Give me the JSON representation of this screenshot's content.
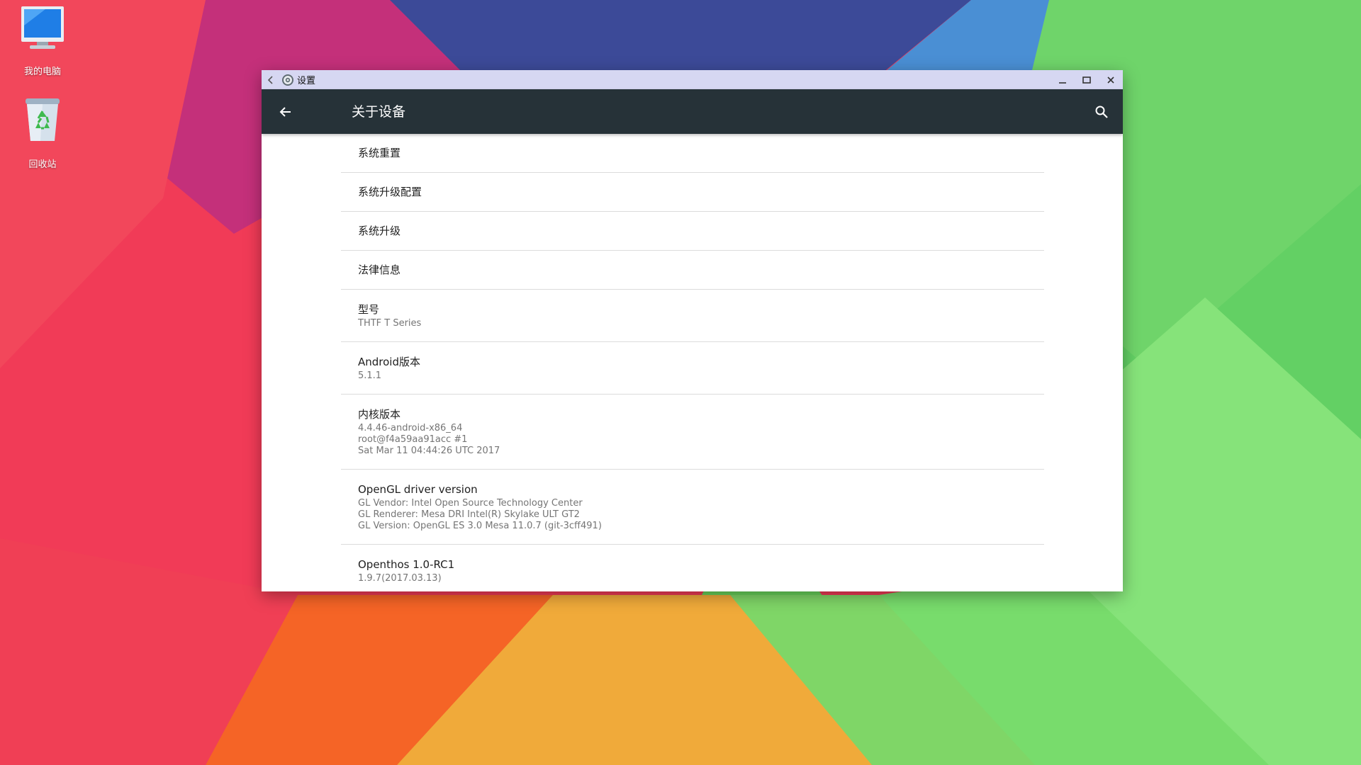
{
  "desktop": {
    "icons": [
      {
        "label": "我的电脑",
        "icon": "computer-icon"
      },
      {
        "label": "回收站",
        "icon": "recycle-bin-icon"
      }
    ]
  },
  "window": {
    "title": "设置",
    "app_icon": "settings-gear-icon",
    "controls": [
      "minimize-icon",
      "maximize-icon",
      "close-icon"
    ]
  },
  "appbar": {
    "title": "关于设备",
    "back_icon": "arrow-back-icon",
    "search_icon": "search-icon",
    "color": "#263238"
  },
  "preferences": [
    {
      "title": "系统重置"
    },
    {
      "title": "系统升级配置"
    },
    {
      "title": "系统升级"
    },
    {
      "title": "法律信息"
    },
    {
      "title": "型号",
      "summary": "THTF T Series"
    },
    {
      "title": "Android版本",
      "summary": "5.1.1"
    },
    {
      "title": "内核版本",
      "summary": "4.4.46-android-x86_64\nroot@f4a59aa91acc #1\nSat Mar 11 04:44:26 UTC 2017"
    },
    {
      "title": "OpenGL driver version",
      "summary": "GL Vendor: Intel Open Source Technology Center\nGL Renderer: Mesa DRI Intel(R) Skylake ULT GT2\nGL Version: OpenGL ES 3.0 Mesa 11.0.7 (git-3cff491)"
    },
    {
      "title": "Openthos 1.0-RC1",
      "summary": "1.9.7(2017.03.13)"
    }
  ],
  "colors": {
    "titlebar": "#d6d7f2",
    "wallpaper_red": "#f03a55",
    "wallpaper_navy": "#3c4a98",
    "wallpaper_green": "#64d25f",
    "wallpaper_orange": "#f0a020"
  }
}
